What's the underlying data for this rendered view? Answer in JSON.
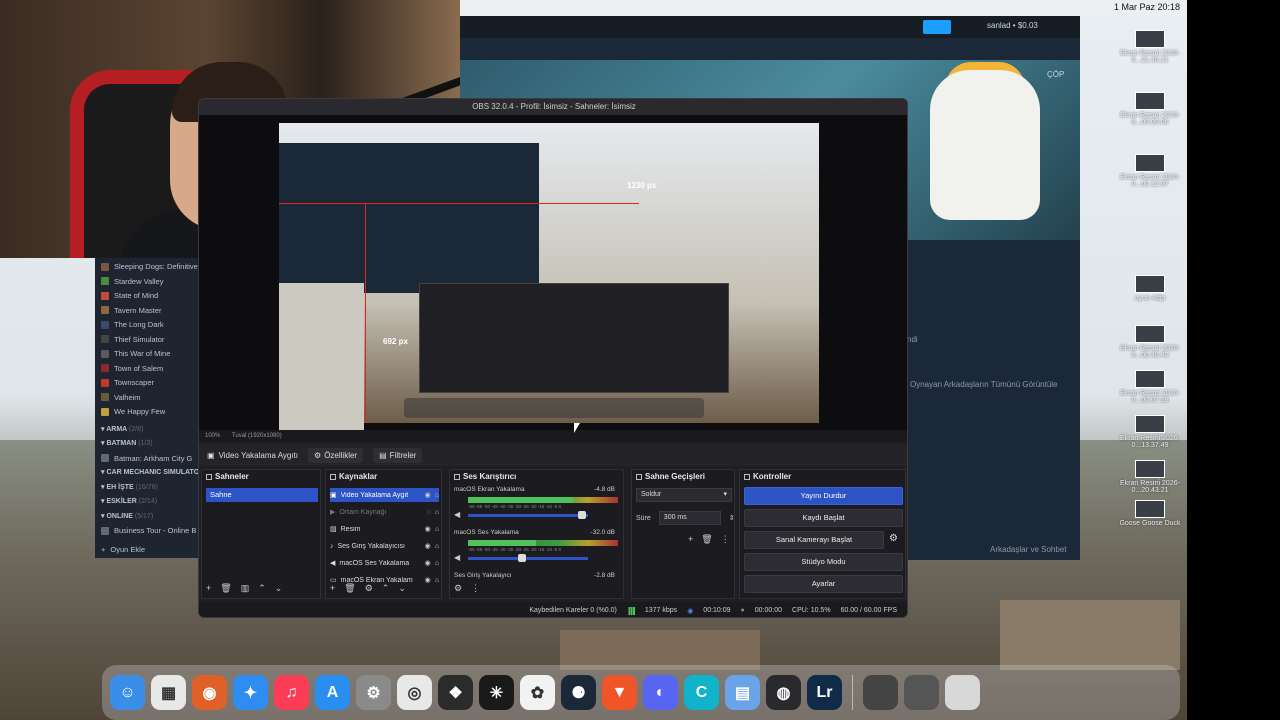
{
  "menubar": {
    "clock": "1 Mar Paz  20:18"
  },
  "browser": {
    "cop_label": "ÇÖP",
    "user_label": "sanlad • $0.03",
    "friends_heading": "ndi",
    "friends_view_all": "Oynayan Arkadaşların Tümünü Görüntüle",
    "friends_chat": "Arkadaşlar ve Sohbet"
  },
  "library": {
    "items": [
      {
        "label": "Sleeping Dogs: Definitive",
        "color": "#7a5a3a"
      },
      {
        "label": "Stardew Valley",
        "color": "#4d8a3d"
      },
      {
        "label": "State of Mind",
        "color": "#c24c3a"
      },
      {
        "label": "Tavern Master",
        "color": "#8a6a3a"
      },
      {
        "label": "The Long Dark",
        "color": "#3a4a6a"
      },
      {
        "label": "Thief Simulator",
        "color": "#444"
      },
      {
        "label": "This War of Mine",
        "color": "#5a5a5a"
      },
      {
        "label": "Town of Salem",
        "color": "#8a2a2a"
      },
      {
        "label": "Townscaper",
        "color": "#c0392b"
      },
      {
        "label": "Valheim",
        "color": "#6a5a3a"
      },
      {
        "label": "We Happy Few",
        "color": "#c2a23a"
      }
    ],
    "groups": [
      {
        "name": "ARMA",
        "count": "(2/8)"
      },
      {
        "name": "BATMAN",
        "count": "(1/3)"
      },
      {
        "name": "CAR MECHANIC SIMULATO",
        "count": ""
      },
      {
        "name": "EH İŞTE",
        "count": "(16/76)"
      },
      {
        "name": "ESKİLER",
        "count": "(2/14)"
      },
      {
        "name": "ONLINE",
        "count": "(5/17)"
      }
    ],
    "batman_item": "Batman: Arkham City G",
    "online_item": "Business Tour - Online B",
    "add_game": "Oyun Ekle"
  },
  "obs": {
    "title": "OBS 32.0.4 - Profil: İsimsiz - Sahneler: İsimsiz",
    "px_label_1": "1230 px",
    "px_label_2": "692 px",
    "zoom": "100%",
    "canvas": "Tuval (1920x1080)",
    "source_name": "Video Yakalama Aygıtı",
    "properties": "Özellikler",
    "filters": "Filtreler",
    "scenes": {
      "title": "Sahneler",
      "items": [
        "Sahne"
      ]
    },
    "sources": {
      "title": "Kaynaklar",
      "items": [
        {
          "label": "Video Yakalama Aygıt",
          "icon": "camera-icon"
        },
        {
          "label": "Ortam Kaynağı",
          "icon": "play-icon"
        },
        {
          "label": "Resim",
          "icon": "image-icon"
        },
        {
          "label": "Ses Giriş Yakalayıcısı",
          "icon": "mic-icon"
        },
        {
          "label": "macOS Ses Yakalama",
          "icon": "speaker-icon"
        },
        {
          "label": "macOS Ekran Yakalam",
          "icon": "monitor-icon"
        }
      ]
    },
    "mixer": {
      "title": "Ses Karıştırıcı",
      "channels": [
        {
          "name": "macOS Ekran Yakalama",
          "db": "-4.8 dB",
          "level": 0.7,
          "volume": 0.95
        },
        {
          "name": "macOS Ses Yakalama",
          "db": "-32.0 dB",
          "level": 0.45,
          "volume": 0.45
        },
        {
          "name": "Ses Giriş Yakalayıcı",
          "db": "-2.8 dB",
          "level": 0.8,
          "volume": 0.9
        }
      ],
      "ticks": "-60 -55 -50 -45 -40 -35 -30 -25 -20 -15 -10 -5 0"
    },
    "transitions": {
      "title": "Sahne Geçişleri",
      "selected": "Soldur",
      "duration_label": "Süre",
      "duration_value": "300 ms"
    },
    "controls": {
      "title": "Kontroller",
      "buttons": [
        "Yayını Durdur",
        "Kaydı Başlat",
        "Sanal Kamerayı Başlat",
        "Stüdyo Modu",
        "Ayarlar"
      ]
    },
    "status": {
      "dropped": "Kaybedilen Kareler 0 (%0.0)",
      "bitrate": "1377 kbps",
      "stream_time": "00:10:09",
      "record_time": "00:00:00",
      "cpu": "CPU: 10.5%",
      "fps": "60.00 / 60.00 FPS"
    }
  },
  "desktop_files": [
    {
      "label": "Ekran Resmi 2026-0...21.40.21"
    },
    {
      "label": "Ekran Resmi 2026-0...00.09.06"
    },
    {
      "label": "Ekran Resmi 2026-0...00.12.07"
    },
    {
      "label": "oyun-4dpi"
    },
    {
      "label": "Ekran Resmi 2026-0...00.40.40"
    },
    {
      "label": "Ekran Resmi 2026-0...00.07.59"
    },
    {
      "label": "Ekran Resmi 2026-0...13.37.49"
    },
    {
      "label": "Ekran Resmi 2026-0...20.43.21"
    },
    {
      "label": "Goose Goose Duck"
    }
  ],
  "dock": [
    {
      "name": "finder-icon",
      "color": "#3b8ee8",
      "glyph": "☺"
    },
    {
      "name": "launchpad-icon",
      "color": "#e8e8e8",
      "glyph": "▦"
    },
    {
      "name": "firefox-icon",
      "color": "#e0602a",
      "glyph": "◉"
    },
    {
      "name": "safari-icon",
      "color": "#2f8cf0",
      "glyph": "✦"
    },
    {
      "name": "music-icon",
      "color": "#fa3c55",
      "glyph": "♫"
    },
    {
      "name": "app-store-icon",
      "color": "#2a8ef0",
      "glyph": "A"
    },
    {
      "name": "system-settings-icon",
      "color": "#8a8a8a",
      "glyph": "⚙"
    },
    {
      "name": "chrome-icon",
      "color": "#e8e8e8",
      "glyph": "◎"
    },
    {
      "name": "davinci-icon",
      "color": "#2b2b2b",
      "glyph": "❖"
    },
    {
      "name": "perplexity-icon",
      "color": "#1a1a1a",
      "glyph": "✳"
    },
    {
      "name": "chatgpt-icon",
      "color": "#f2f2f2",
      "glyph": "✿"
    },
    {
      "name": "steam-icon",
      "color": "#1b2838",
      "glyph": "⚈"
    },
    {
      "name": "brave-icon",
      "color": "#f0552a",
      "glyph": "▼"
    },
    {
      "name": "discord-icon",
      "color": "#5865f2",
      "glyph": "◐"
    },
    {
      "name": "canva-icon",
      "color": "#10b3c9",
      "glyph": "C"
    },
    {
      "name": "preview-icon",
      "color": "#6aa3e8",
      "glyph": "▤"
    },
    {
      "name": "obs-icon",
      "color": "#2a2a2e",
      "glyph": "◍"
    },
    {
      "name": "lightroom-icon",
      "color": "#0f2b47",
      "glyph": "Lr"
    }
  ],
  "dock_right": [
    {
      "name": "screenshot-icon",
      "color": "#444"
    },
    {
      "name": "window-icon",
      "color": "#555"
    },
    {
      "name": "trash-icon",
      "color": "#d8d8d8"
    }
  ]
}
